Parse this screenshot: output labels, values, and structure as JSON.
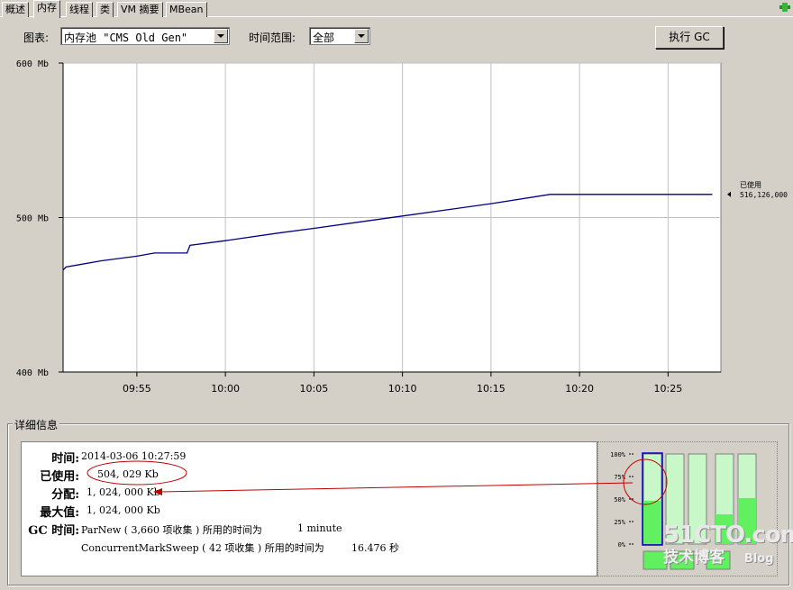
{
  "tabs": [
    {
      "label": "概述",
      "active": false
    },
    {
      "label": "内存",
      "active": true
    },
    {
      "label": "线程",
      "active": false
    },
    {
      "label": "类",
      "active": false
    },
    {
      "label": "VM 摘要",
      "active": false
    },
    {
      "label": "MBean",
      "active": false
    }
  ],
  "toolbar": {
    "chart_label": "图表:",
    "chart_value": "内存池 \"CMS Old Gen\"",
    "range_label": "时间范围:",
    "range_value": "全部",
    "gc_button": "执行 GC"
  },
  "chart_data": {
    "type": "line",
    "y_unit": "Mb",
    "ylim": [
      400,
      600
    ],
    "y_ticks": [
      "600 Mb",
      "500 Mb",
      "400 Mb"
    ],
    "x_ticks": [
      "09:55",
      "10:00",
      "10:05",
      "10:10",
      "10:15",
      "10:20",
      "10:25"
    ],
    "xlim": [
      "09:50:50",
      "10:27:59"
    ],
    "series": [
      {
        "name": "已使用",
        "color": "#000080",
        "points": [
          [
            "09:50:50",
            466
          ],
          [
            "09:51:00",
            468
          ],
          [
            "09:51:30",
            469
          ],
          [
            "09:53:00",
            472
          ],
          [
            "09:55:00",
            475
          ],
          [
            "09:56:00",
            477
          ],
          [
            "09:57:50",
            477
          ],
          [
            "09:58:00",
            482
          ],
          [
            "10:00:00",
            485
          ],
          [
            "10:03:00",
            490
          ],
          [
            "10:05:00",
            493
          ],
          [
            "10:10:00",
            501
          ],
          [
            "10:15:00",
            509
          ],
          [
            "10:18:20",
            515
          ],
          [
            "10:27:30",
            515
          ]
        ]
      }
    ],
    "annotation": {
      "label": "已使用",
      "value": "516,126,000"
    },
    "grid": true
  },
  "details": {
    "title": "详细信息",
    "time_label": "时间:",
    "time_value": "2014-03-06 10:27:59",
    "used_label": "已使用:",
    "used_value": "504, 029 Kb",
    "committed_label": "分配:",
    "committed_value": "1, 024, 000 Kb",
    "max_label": "最大值:",
    "max_value": "1, 024, 000 Kb",
    "gc_label": "GC 时间:",
    "gc_rows": [
      {
        "text": "ParNew ( 3,660 项收集 ) 所用的时间为",
        "duration": "1 minute"
      },
      {
        "text": "ConcurrentMarkSweep ( 42 项收集 ) 所用的时间为",
        "duration": "16.476 秒"
      }
    ]
  },
  "pool_bars": {
    "ticks": [
      "100%",
      "75%",
      "50%",
      "25%",
      "0%"
    ],
    "levels": [
      0.48,
      0.0,
      0.0,
      0.33,
      0.51,
      0.0
    ],
    "selected_index": 0,
    "colors": {
      "fill": "#60f060",
      "empty": "#c8f8c8",
      "selected_border": "#0000c0"
    }
  },
  "watermark": {
    "line1": "51CTO.com",
    "line2": "技术博客",
    "line3": "Blog"
  },
  "annotation_colors": {
    "ellipse": "#c00000",
    "arrow": "#c00000"
  }
}
